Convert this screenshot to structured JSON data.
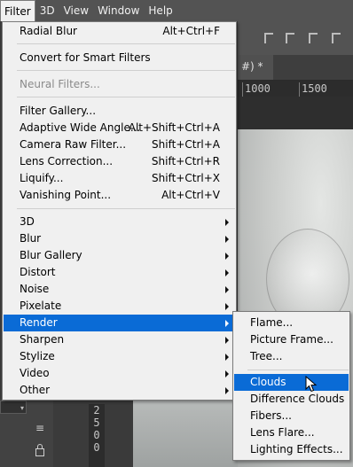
{
  "menubar": {
    "items": [
      {
        "label": "Filter",
        "active": true
      },
      {
        "label": "3D"
      },
      {
        "label": "View"
      },
      {
        "label": "Window"
      },
      {
        "label": "Help"
      }
    ]
  },
  "document": {
    "tab_label": "#) *",
    "ruler_ticks": [
      "1000",
      "1500"
    ],
    "vertical_ruler": "2\n5\n0\n0"
  },
  "filter_menu": {
    "last_filter": {
      "label": "Radial Blur",
      "shortcut": "Alt+Ctrl+F"
    },
    "convert_smart": {
      "label": "Convert for Smart Filters"
    },
    "neural_filters": {
      "label": "Neural Filters...",
      "disabled": true
    },
    "gallery_items": [
      {
        "label": "Filter Gallery...",
        "shortcut": ""
      },
      {
        "label": "Adaptive Wide Angle...",
        "shortcut": "Alt+Shift+Ctrl+A"
      },
      {
        "label": "Camera Raw Filter...",
        "shortcut": "Shift+Ctrl+A"
      },
      {
        "label": "Lens Correction...",
        "shortcut": "Shift+Ctrl+R"
      },
      {
        "label": "Liquify...",
        "shortcut": "Shift+Ctrl+X"
      },
      {
        "label": "Vanishing Point...",
        "shortcut": "Alt+Ctrl+V"
      }
    ],
    "submenus": [
      {
        "label": "3D"
      },
      {
        "label": "Blur"
      },
      {
        "label": "Blur Gallery"
      },
      {
        "label": "Distort"
      },
      {
        "label": "Noise"
      },
      {
        "label": "Pixelate"
      },
      {
        "label": "Render",
        "highlighted": true
      },
      {
        "label": "Sharpen"
      },
      {
        "label": "Stylize"
      },
      {
        "label": "Video"
      },
      {
        "label": "Other"
      }
    ]
  },
  "render_submenu": {
    "group1": [
      {
        "label": "Flame..."
      },
      {
        "label": "Picture Frame..."
      },
      {
        "label": "Tree..."
      }
    ],
    "group2": [
      {
        "label": "Clouds",
        "highlighted": true
      },
      {
        "label": "Difference Clouds"
      },
      {
        "label": "Fibers..."
      },
      {
        "label": "Lens Flare..."
      },
      {
        "label": "Lighting Effects..."
      }
    ]
  },
  "colors": {
    "menu_bg": "#f0f0f0",
    "highlight": "#0a6bd6",
    "menubar_bg": "#535353",
    "workspace": "#3b3b3b"
  },
  "icons": [
    "submenu-arrow-icon",
    "align-icon",
    "hamburger-icon",
    "lock-icon",
    "mouse-pointer-icon"
  ]
}
